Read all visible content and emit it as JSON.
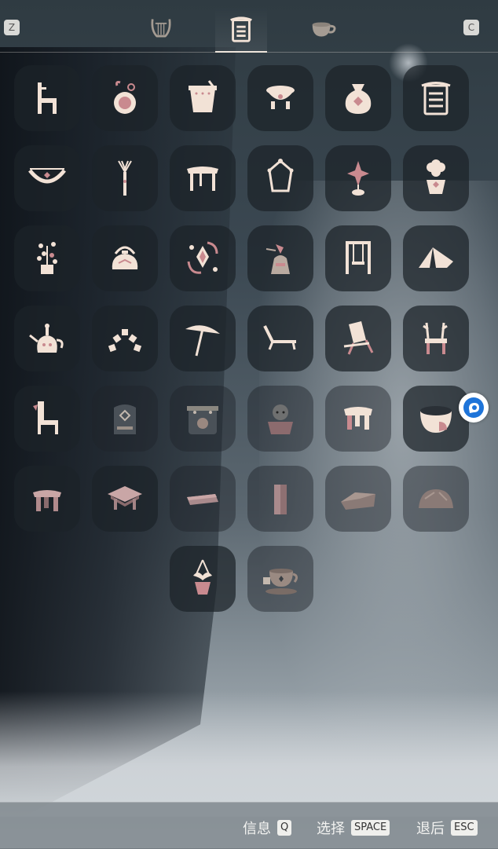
{
  "colors": {
    "icon_fill": "#f2e2d6",
    "icon_accent": "#c98a8f",
    "slot_bg": "#1c2228"
  },
  "topbar": {
    "left_key": "Z",
    "right_key": "C",
    "tabs": [
      {
        "icon": "lyre-icon",
        "active": false
      },
      {
        "icon": "furniture-icon",
        "active": true
      },
      {
        "icon": "teacup-icon",
        "active": false
      }
    ]
  },
  "grid": {
    "items": [
      {
        "icon": "chair-icon"
      },
      {
        "icon": "perfume-bottle-icon"
      },
      {
        "icon": "bucket-icon"
      },
      {
        "icon": "pot-stool-icon"
      },
      {
        "icon": "pouch-icon"
      },
      {
        "icon": "cabinet-icon"
      },
      {
        "icon": "hammock-icon"
      },
      {
        "icon": "torch-icon"
      },
      {
        "icon": "table-icon"
      },
      {
        "icon": "lantern-frame-icon"
      },
      {
        "icon": "sparkle-lamp-icon"
      },
      {
        "icon": "flower-vase-icon"
      },
      {
        "icon": "plant-pot-icon"
      },
      {
        "icon": "kettle-icon"
      },
      {
        "icon": "orbit-ornament-icon"
      },
      {
        "icon": "bell-statue-icon"
      },
      {
        "icon": "swing-icon"
      },
      {
        "icon": "tent-icon"
      },
      {
        "icon": "teapot-icon"
      },
      {
        "icon": "arch-icon"
      },
      {
        "icon": "parasol-icon"
      },
      {
        "icon": "lounger-icon"
      },
      {
        "icon": "deck-chair-icon"
      },
      {
        "icon": "antler-chair-icon"
      },
      {
        "icon": "llama-chair-icon"
      },
      {
        "icon": "stone-tablet-icon"
      },
      {
        "icon": "stove-icon"
      },
      {
        "icon": "pot-creature-icon"
      },
      {
        "icon": "stool-icon"
      },
      {
        "icon": "bowl-icon"
      },
      {
        "icon": "small-stool-icon"
      },
      {
        "icon": "side-table-icon"
      },
      {
        "icon": "flat-stone-icon"
      },
      {
        "icon": "pillar-stone-icon"
      },
      {
        "icon": "slab-stone-icon"
      },
      {
        "icon": "rock-icon"
      },
      {
        "icon": "hanging-planter-icon"
      },
      {
        "icon": "teacup-set-icon"
      }
    ]
  },
  "bottombar": {
    "hints": [
      {
        "label": "信息",
        "key": "Q"
      },
      {
        "label": "选择",
        "key": "SPACE"
      },
      {
        "label": "退后",
        "key": "ESC"
      }
    ]
  }
}
